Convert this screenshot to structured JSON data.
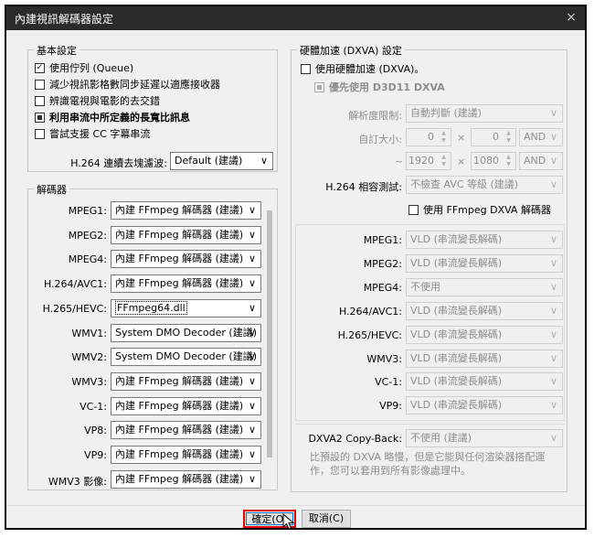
{
  "window": {
    "title": "內建視訊解碼器設定",
    "close_glyph": "×"
  },
  "basic": {
    "legend": "基本設定",
    "options": [
      {
        "label": "使用佇列 (Queue)",
        "state": "checked",
        "bold": false
      },
      {
        "label": "減少視訊影格數同步延遲以適應接收器",
        "state": "unchecked",
        "bold": false
      },
      {
        "label": "辨識電視與電影的去交錯",
        "state": "unchecked",
        "bold": false
      },
      {
        "label": "利用串流中所定義的長寬比訊息",
        "state": "indeterminate",
        "bold": true
      },
      {
        "label": "嘗試支援 CC 字幕串流",
        "state": "unchecked",
        "bold": false
      }
    ],
    "h264_deblock_label": "H.264 連續去塊濾波:",
    "h264_deblock_value": "Default (建議)"
  },
  "decoders": {
    "legend": "解碼器",
    "rows": [
      {
        "label": "MPEG1:",
        "value": "內建 FFmpeg 解碼器 (建議)"
      },
      {
        "label": "MPEG2:",
        "value": "內建 FFmpeg 解碼器 (建議)"
      },
      {
        "label": "MPEG4:",
        "value": "內建 FFmpeg 解碼器 (建議)"
      },
      {
        "label": "H.264/AVC1:",
        "value": "內建 FFmpeg 解碼器 (建議)"
      },
      {
        "label": "H.265/HEVC:",
        "value": "FFmpeg64.dll"
      },
      {
        "label": "WMV1:",
        "value": "System DMO Decoder (建議)"
      },
      {
        "label": "WMV2:",
        "value": "System DMO Decoder (建議)"
      },
      {
        "label": "WMV3:",
        "value": "內建 FFmpeg 解碼器 (建議)"
      },
      {
        "label": "VC-1:",
        "value": "內建 FFmpeg 解碼器 (建議)"
      },
      {
        "label": "VP8:",
        "value": "內建 FFmpeg 解碼器 (建議)"
      },
      {
        "label": "VP9:",
        "value": "內建 FFmpeg 解碼器 (建議)"
      },
      {
        "label": "WMV3 影像:",
        "value": "內建 FFmpeg 解碼器 (建議)"
      }
    ]
  },
  "hw": {
    "legend": "硬體加速 (DXVA) 設定",
    "use_hw_label": "使用硬體加速 (DXVA)。",
    "prefer_d3d11_label": "優先使用 D3D11 DXVA",
    "resolution_label": "解析度限制:",
    "resolution_value": "自動判斷 (建議)",
    "custom_size_label": "自訂大小:",
    "custom_w1": "0",
    "custom_h1": "0",
    "and1": "AND",
    "tilde": "~",
    "custom_w2": "1920",
    "custom_h2": "1080",
    "and2": "AND",
    "times": "×",
    "h264_compat_label": "H.264 相容測試:",
    "h264_compat_value": "不檢查 AVC 等級 (建議)",
    "ffmpeg_dxva_label": "使用 FFmpeg DXVA 解碼器",
    "rows": [
      {
        "label": "MPEG1:",
        "value": "VLD (串流變長解碼)"
      },
      {
        "label": "MPEG2:",
        "value": "VLD (串流變長解碼)"
      },
      {
        "label": "MPEG4:",
        "value": "不使用"
      },
      {
        "label": "H.264/AVC1:",
        "value": "VLD (串流變長解碼)"
      },
      {
        "label": "H.265/HEVC:",
        "value": "VLD (串流變長解碼)"
      },
      {
        "label": "WMV3:",
        "value": "VLD (串流變長解碼)"
      },
      {
        "label": "VC-1:",
        "value": "VLD (串流變長解碼)"
      },
      {
        "label": "VP9:",
        "value": "VLD (串流變長解碼)"
      }
    ],
    "copyback_label": "DXVA2 Copy-Back:",
    "copyback_value": "不使用 (建議)",
    "note_line1": "比預設的 DXVA 略慢，但是它能與任何渲染器搭配運",
    "note_line2": "作，您可以套用到所有影像處理中。"
  },
  "buttons": {
    "ok": "確定(O)",
    "cancel": "取消(C)"
  }
}
